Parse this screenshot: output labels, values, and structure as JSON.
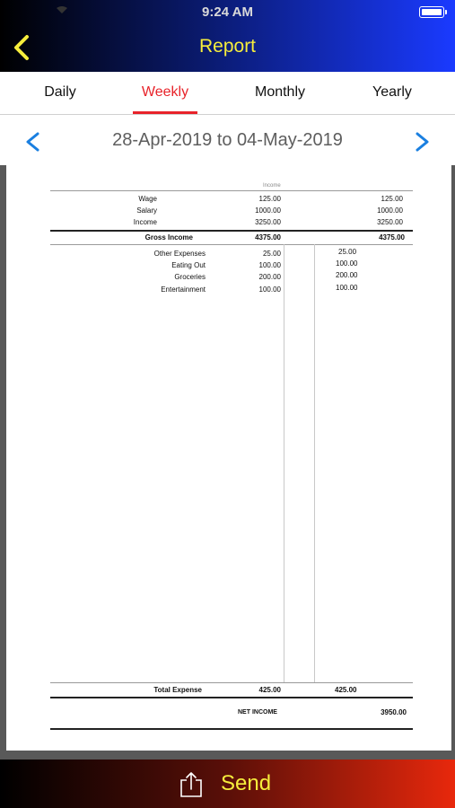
{
  "status_bar": {
    "time": "9:24 AM"
  },
  "header": {
    "title": "Report"
  },
  "tabs": [
    {
      "label": "Daily"
    },
    {
      "label": "Weekly"
    },
    {
      "label": "Monthly"
    },
    {
      "label": "Yearly"
    }
  ],
  "date_nav": {
    "range": "28-Apr-2019 to 04-May-2019"
  },
  "report": {
    "column_header": "Income",
    "income_rows": [
      {
        "label": "Wage",
        "amount": "125.00",
        "total": "125.00"
      },
      {
        "label": "Salary",
        "amount": "1000.00",
        "total": "1000.00"
      },
      {
        "label": "Income",
        "amount": "3250.00",
        "total": "3250.00"
      }
    ],
    "gross": {
      "label": "Gross Income",
      "amount": "4375.00",
      "total": "4375.00"
    },
    "expense_rows": [
      {
        "label": "Other Expenses",
        "amount": "25.00",
        "total": "25.00"
      },
      {
        "label": "Eating Out",
        "amount": "100.00",
        "total": "100.00"
      },
      {
        "label": "Groceries",
        "amount": "200.00",
        "total": "200.00"
      },
      {
        "label": "Entertainment",
        "amount": "100.00",
        "total": "100.00"
      }
    ],
    "total_expense": {
      "label": "Total Expense",
      "amount": "425.00",
      "total": "425.00"
    },
    "net_income": {
      "label": "NET INCOME",
      "amount": "3950.00"
    }
  },
  "footer": {
    "send_label": "Send"
  }
}
